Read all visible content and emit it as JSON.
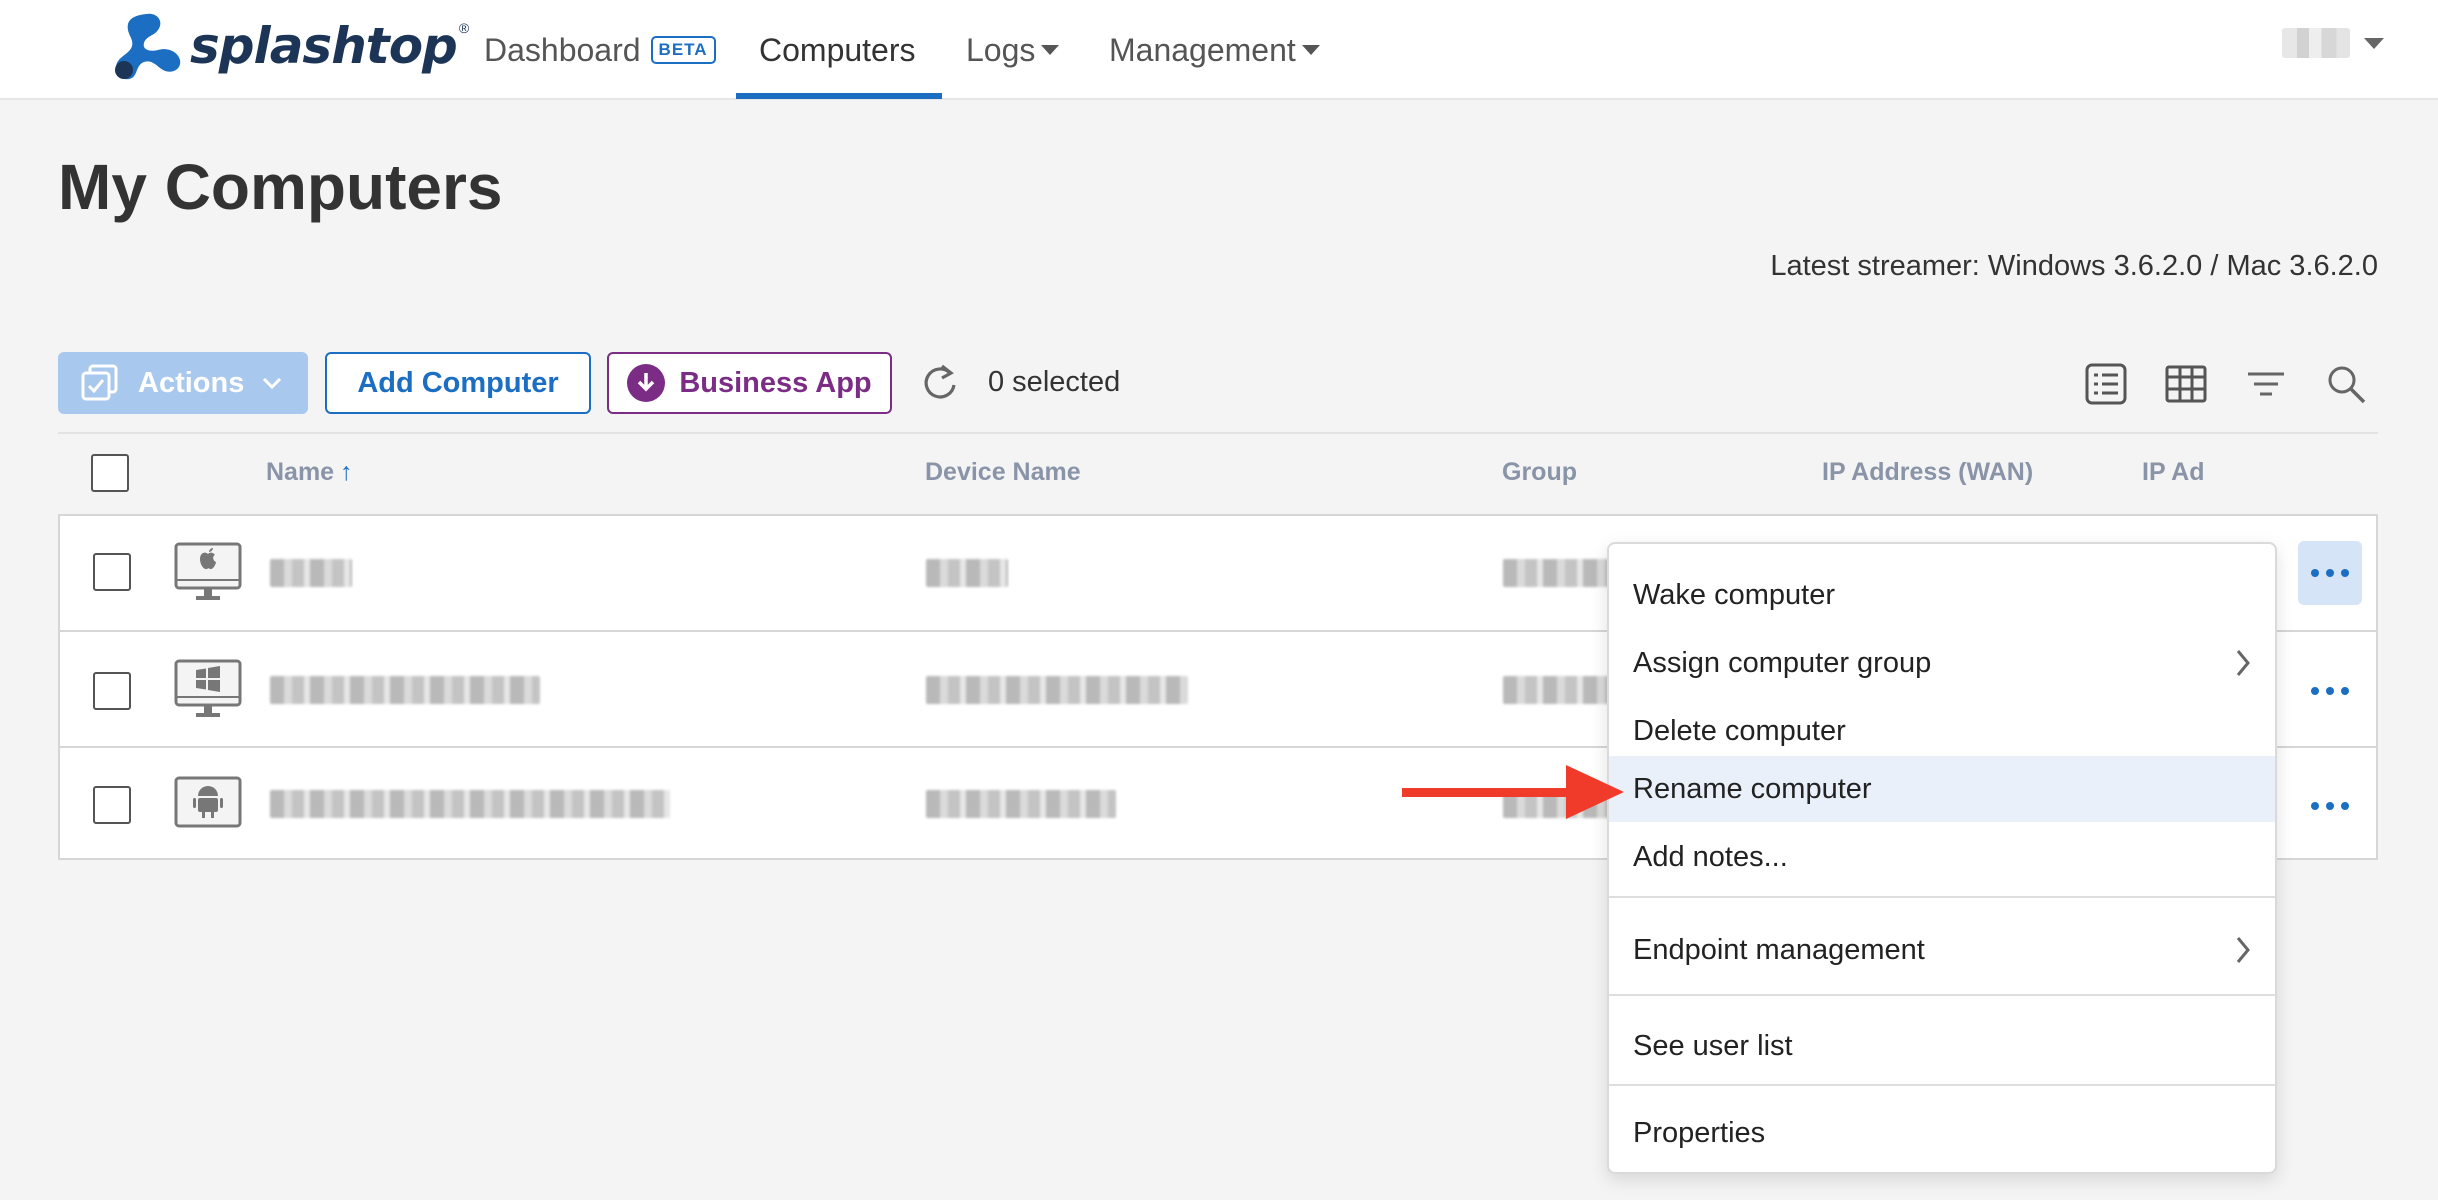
{
  "brand": {
    "name": "splashtop",
    "reg": "®",
    "color": "#1c3556"
  },
  "nav": {
    "dashboard": "Dashboard",
    "dashboard_badge": "BETA",
    "computers": "Computers",
    "logs": "Logs",
    "management": "Management",
    "active_tab": "Computers"
  },
  "page": {
    "title": "My Computers",
    "latest_streamer": "Latest streamer: Windows 3.6.2.0 / Mac 3.6.2.0"
  },
  "toolbar": {
    "actions_label": "Actions",
    "add_computer_label": "Add Computer",
    "business_app_label": "Business App",
    "selected_count": "0 selected",
    "view_icons": [
      "list-view-icon",
      "grid-view-icon",
      "filter-icon",
      "search-icon"
    ]
  },
  "table": {
    "columns": [
      "Name",
      "Device Name",
      "Group",
      "IP Address (WAN)",
      "IP Ad"
    ],
    "sort_column": "Name",
    "sort_direction": "ascending",
    "rows": [
      {
        "os": "mac",
        "checked": false
      },
      {
        "os": "windows",
        "checked": false
      },
      {
        "os": "android",
        "checked": false
      }
    ]
  },
  "context_menu": {
    "items": [
      {
        "label": "Wake computer",
        "submenu": false
      },
      {
        "label": "Assign computer group",
        "submenu": true
      },
      {
        "label": "Delete computer",
        "submenu": false
      },
      {
        "label": "Rename computer",
        "submenu": false,
        "highlighted": true
      },
      {
        "label": "Add notes...",
        "submenu": false
      },
      {
        "label": "Endpoint management",
        "submenu": true
      },
      {
        "label": "See user list",
        "submenu": false
      },
      {
        "label": "Properties",
        "submenu": false
      }
    ]
  },
  "colors": {
    "accent": "#1b6ec2",
    "business": "#7b2d86",
    "actions_disabled": "#a9c8ee",
    "annotation_arrow": "#f03a2a",
    "menu_highlight": "#e9f0fa"
  }
}
